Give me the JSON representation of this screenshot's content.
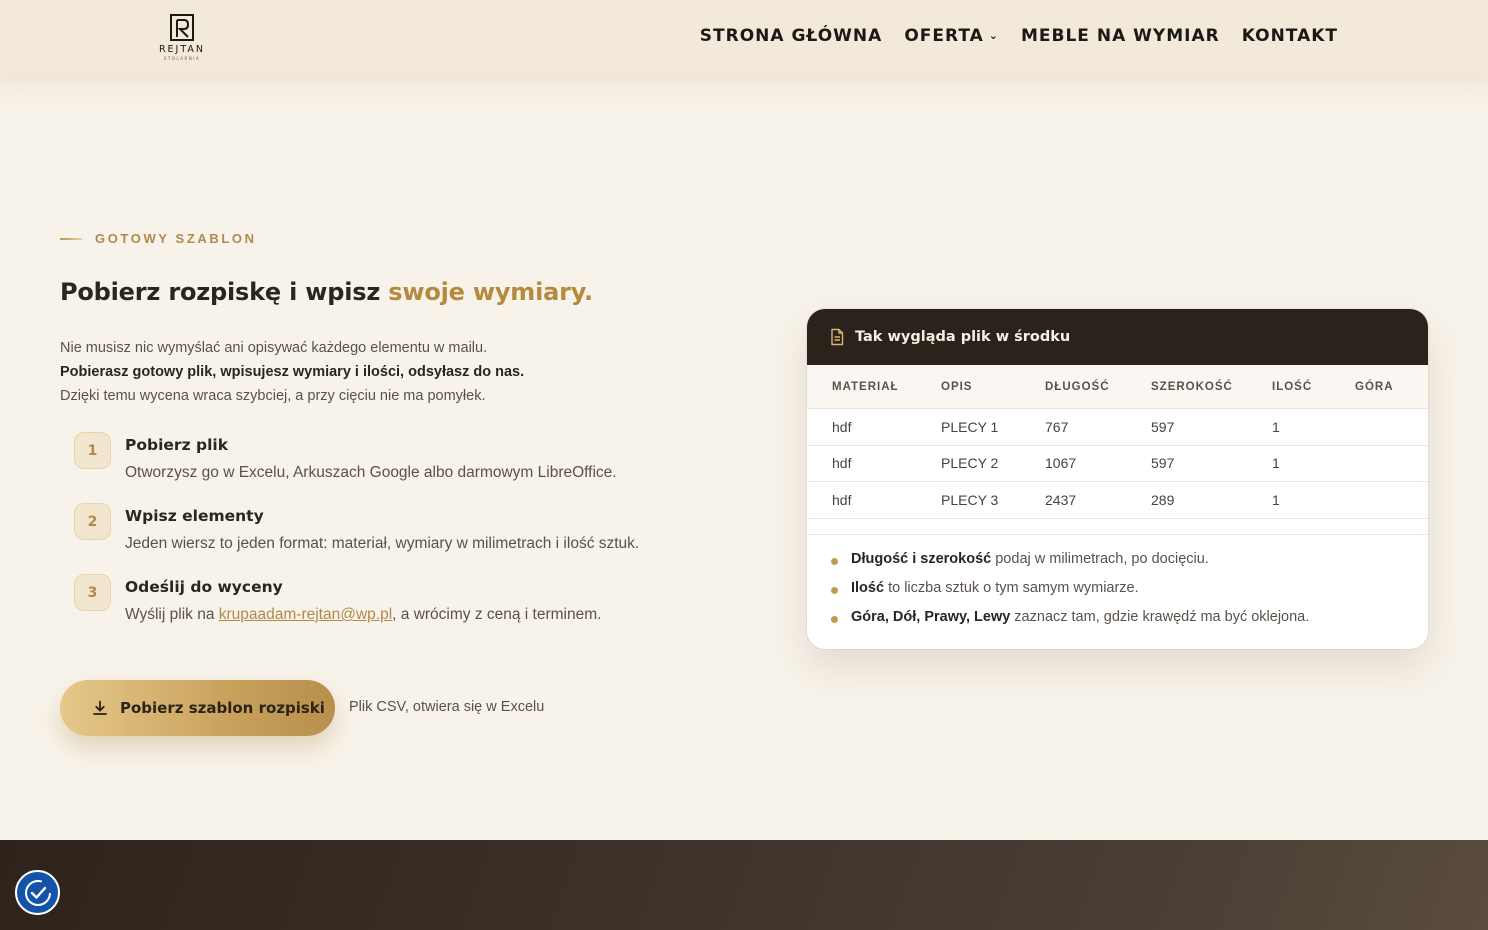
{
  "header": {
    "logo": {
      "name": "REJTAN",
      "sub": "STOLARNIA"
    },
    "nav": [
      {
        "label": "STRONA GŁÓWNA"
      },
      {
        "label": "OFERTA",
        "has_dropdown": true
      },
      {
        "label": "MEBLE NA WYMIAR"
      },
      {
        "label": "KONTAKT"
      }
    ]
  },
  "section": {
    "eyebrow": "GOTOWY SZABLON",
    "title_main": "Pobierz rozpiskę i wpisz ",
    "title_accent": "swoje wymiary.",
    "intro_line1": "Nie musisz nic wymyślać ani opisywać każdego elementu w mailu.",
    "intro_line2": "Pobierasz gotowy plik, wpisujesz wymiary i ilości, odsyłasz do nas.",
    "intro_line3": "Dzięki temu wycena wraca szybciej, a przy cięciu nie ma pomyłek.",
    "steps": [
      {
        "num": "1",
        "title": "Pobierz plik",
        "desc": "Otworzysz go w Excelu, Arkuszach Google albo darmowym LibreOffice."
      },
      {
        "num": "2",
        "title": "Wpisz elementy",
        "desc": "Jeden wiersz to jeden format: materiał, wymiary w milimetrach i ilość sztuk."
      },
      {
        "num": "3",
        "title": "Odeślij do wyceny",
        "desc_pre": "Wyślij plik na ",
        "email": "krupaadam-rejtan@wp.pl",
        "desc_post": ", a wrócimy z ceną i terminem."
      }
    ],
    "cta_label": "Pobierz szablon rozpiski",
    "cta_note": "Plik CSV, otwiera się w Excelu"
  },
  "preview_card": {
    "heading": "Tak wygląda plik w środku",
    "columns": [
      "MATERIAŁ",
      "OPIS",
      "DŁUGOŚĆ",
      "SZEROKOŚĆ",
      "ILOŚĆ",
      "GÓRA"
    ],
    "rows": [
      [
        "hdf",
        "PLECY 1",
        "767",
        "597",
        "1",
        ""
      ],
      [
        "hdf",
        "PLECY 2",
        "1067",
        "597",
        "1",
        ""
      ],
      [
        "hdf",
        "PLECY 3",
        "2437",
        "289",
        "1",
        ""
      ]
    ],
    "notes": [
      {
        "strong": "Długość i szerokość",
        "text": " podaj w milimetrach, po docięciu."
      },
      {
        "strong": "Ilość",
        "text": " to liczba sztuk o tym samym wymiarze."
      },
      {
        "strong": "Góra, Dół, Prawy, Lewy",
        "text": " zaznacz tam, gdzie krawędź ma być oklejona."
      }
    ]
  },
  "colors": {
    "accent": "#b58a3e",
    "dark": "#2a221b",
    "background": "#f8f3ea",
    "accessibility_button": "#1454a8"
  },
  "icons": [
    "download-icon",
    "document-icon",
    "chevron-down-icon",
    "accessibility-icon"
  ]
}
